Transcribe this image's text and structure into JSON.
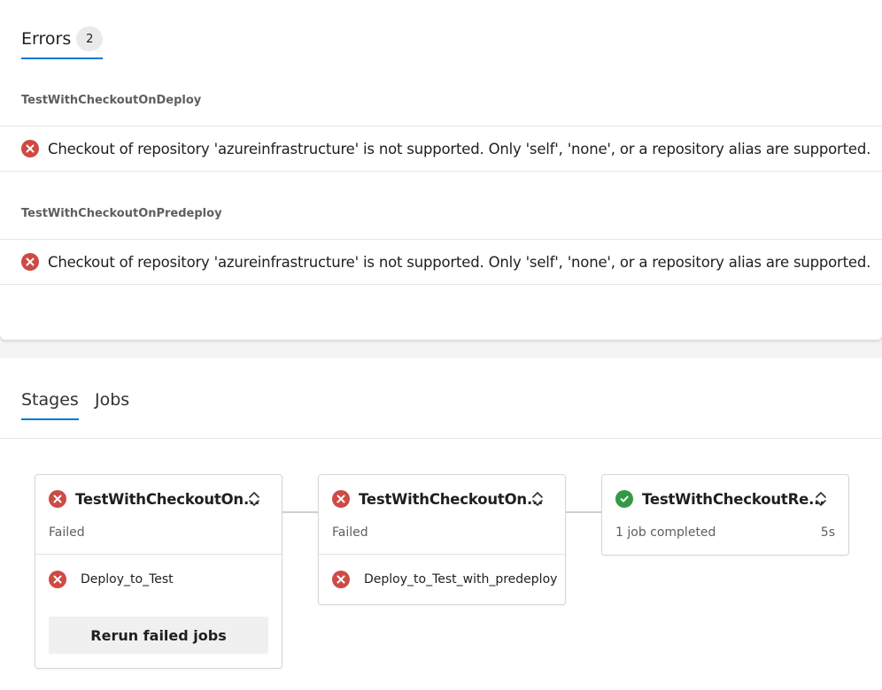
{
  "errors": {
    "tab_label": "Errors",
    "count": "2",
    "groups": [
      {
        "title": "TestWithCheckoutOnDeploy",
        "message": "Checkout of repository 'azureinfrastructure' is not supported. Only 'self', 'none', or a repository alias are supported."
      },
      {
        "title": "TestWithCheckoutOnPredeploy",
        "message": "Checkout of repository 'azureinfrastructure' is not supported. Only 'self', 'none', or a repository alias are supported."
      }
    ]
  },
  "tabs": [
    "Stages",
    "Jobs"
  ],
  "stages": [
    {
      "name": "TestWithCheckoutOn...",
      "status": "Failed",
      "state": "error",
      "jobs": [
        "Deploy_to_Test"
      ],
      "action_label": "Rerun failed jobs"
    },
    {
      "name": "TestWithCheckoutOn...",
      "status": "Failed",
      "state": "error",
      "jobs": [
        "Deploy_to_Test_with_predeploy"
      ]
    },
    {
      "name": "TestWithCheckoutRe...",
      "status": "1 job completed",
      "duration": "5s",
      "state": "success"
    }
  ],
  "colors": {
    "accent": "#0078d4",
    "error": "#cd4a45",
    "success": "#339947"
  }
}
